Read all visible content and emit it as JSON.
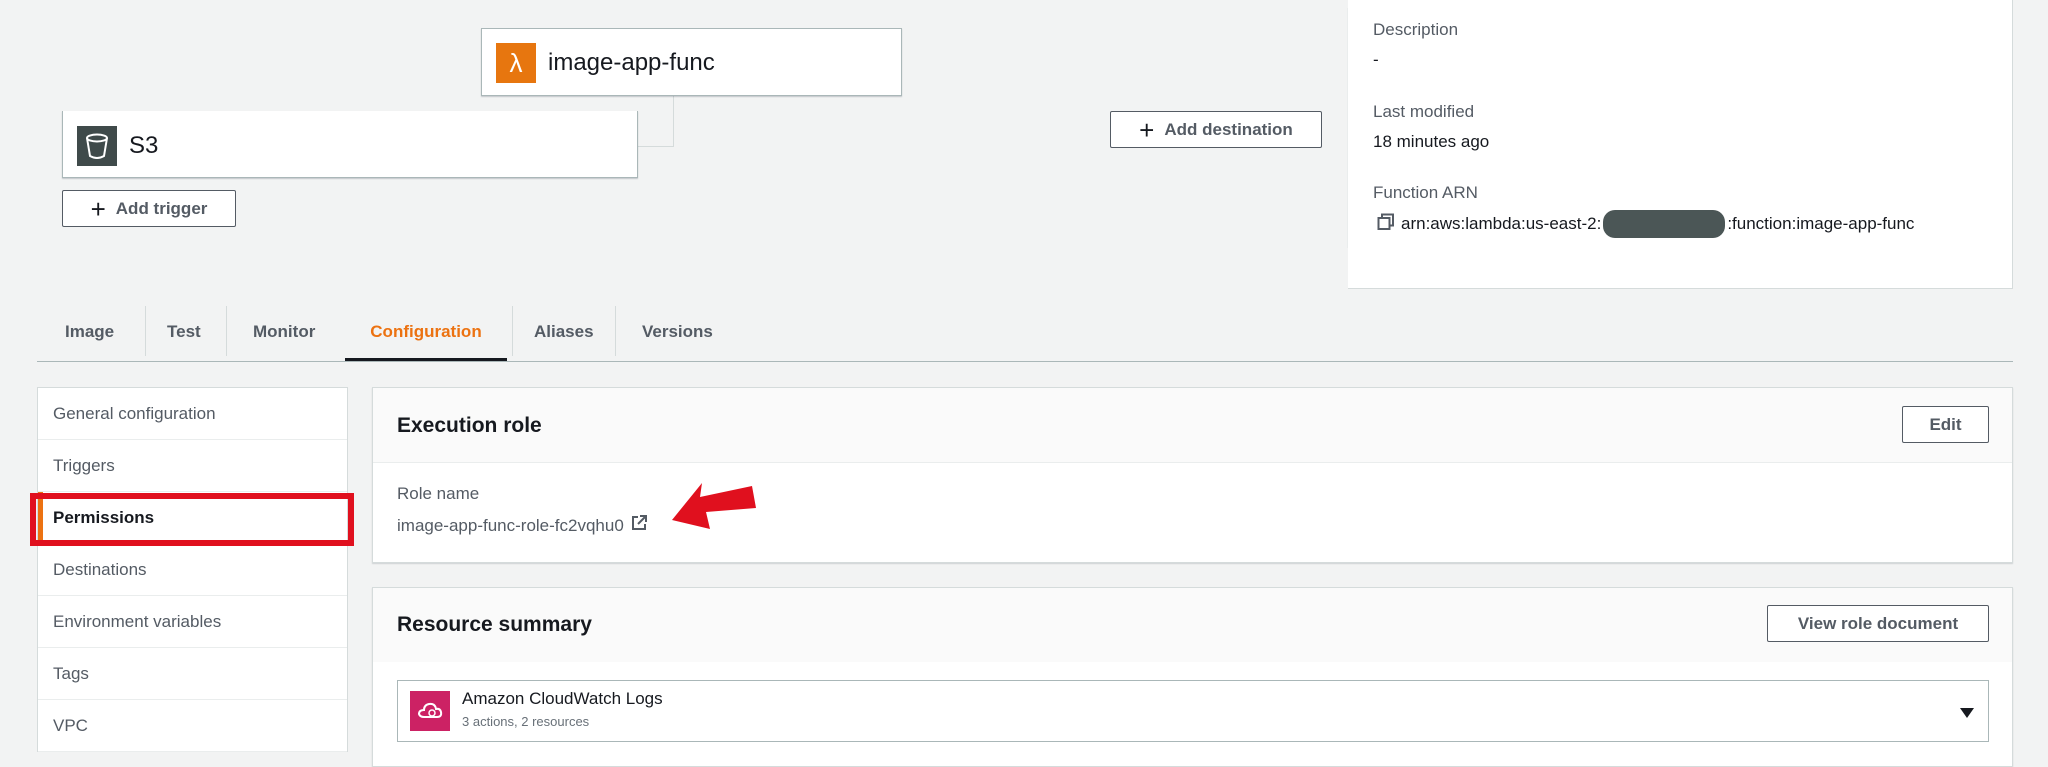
{
  "diagram": {
    "function_name": "image-app-func",
    "trigger_name": "S3",
    "add_trigger_label": "Add trigger",
    "add_destination_label": "Add destination"
  },
  "details": {
    "description_label": "Description",
    "description_value": "-",
    "last_modified_label": "Last modified",
    "last_modified_value": "18 minutes ago",
    "arn_label": "Function ARN",
    "arn_prefix": "arn:aws:lambda:us-east-2:",
    "arn_suffix": ":function:image-app-func"
  },
  "tabs": [
    {
      "label": "Image"
    },
    {
      "label": "Test"
    },
    {
      "label": "Monitor"
    },
    {
      "label": "Configuration"
    },
    {
      "label": "Aliases"
    },
    {
      "label": "Versions"
    }
  ],
  "active_tab": "Configuration",
  "sidebar": {
    "items": [
      {
        "label": "General configuration"
      },
      {
        "label": "Triggers"
      },
      {
        "label": "Permissions"
      },
      {
        "label": "Destinations"
      },
      {
        "label": "Environment variables"
      },
      {
        "label": "Tags"
      },
      {
        "label": "VPC"
      }
    ],
    "active": "Permissions"
  },
  "execution_role": {
    "title": "Execution role",
    "edit_label": "Edit",
    "role_name_label": "Role name",
    "role_name_value": "image-app-func-role-fc2vqhu0"
  },
  "resource_summary": {
    "title": "Resource summary",
    "view_button_label": "View role document",
    "service_name": "Amazon CloudWatch Logs",
    "service_detail": "3 actions, 2 resources"
  },
  "colors": {
    "accent": "#ec7211",
    "annotation": "#e0101e",
    "lambda": "#e7760f",
    "cloudwatch": "#cc2264"
  }
}
